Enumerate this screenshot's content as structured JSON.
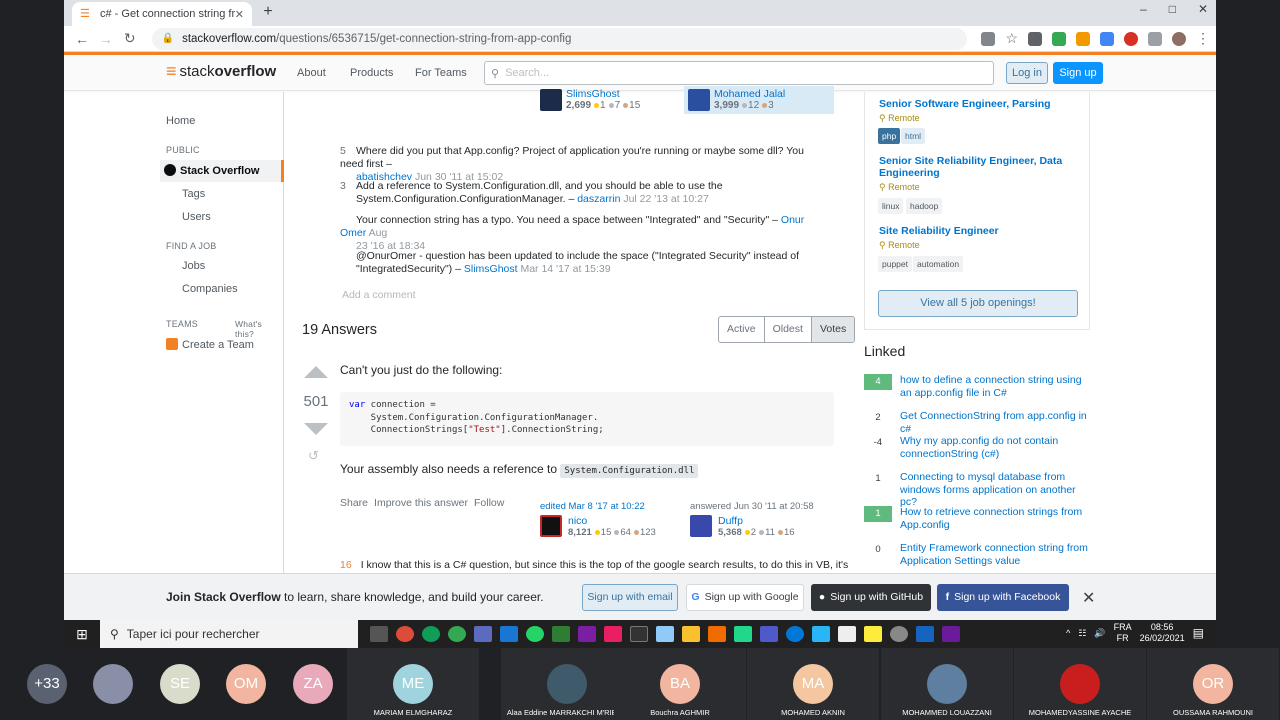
{
  "browser": {
    "tab_title": "c# - Get connection string from ...",
    "url_host": "stackoverflow.com",
    "url_path": "/questions/6536715/get-connection-string-from-app-config"
  },
  "so_header": {
    "logo_text_a": "stack",
    "logo_text_b": "overflow",
    "nav": [
      "About",
      "Products",
      "For Teams"
    ],
    "search_placeholder": "Search...",
    "login": "Log in",
    "signup": "Sign up"
  },
  "left_nav": {
    "home": "Home",
    "public_header": "PUBLIC",
    "stack_overflow": "Stack Overflow",
    "tags": "Tags",
    "users": "Users",
    "find_job_header": "FIND A JOB",
    "jobs": "Jobs",
    "companies": "Companies",
    "teams_header": "TEAMS",
    "whats_this": "What's this?",
    "create_team": "Create a Team"
  },
  "question_users": [
    {
      "name": "SlimsGhost",
      "rep": "2,699",
      "gold": "1",
      "silver": "7",
      "bronze": "15"
    },
    {
      "name": "Mohamed Jalal",
      "rep": "3,999",
      "silver": "12",
      "bronze": "3"
    }
  ],
  "comments": [
    {
      "score": "5",
      "text": "Where did you put that App.config? Project of application you're running or maybe some dll? You need first –",
      "user": "abatishchev",
      "date": "Jun 30 '11 at 15:02"
    },
    {
      "score": "3",
      "text1": "Add a reference to System.Configuration.dll, and you should be able to use the",
      "text2": "System.Configuration.ConfigurationManager. –",
      "user": "daszarrin",
      "date": "Jul 22 '13 at 10:27"
    },
    {
      "score": "",
      "text": "Your connection string has a typo. You need a space between \"Integrated\" and \"Security\" –",
      "user": "Onur Omer",
      "date_a": "Aug",
      "date_b": "23 '16 at 18:34"
    },
    {
      "score": "",
      "text1": "@OnurOmer - question has been updated to include the space (\"Integrated Security\" instead of",
      "text2": "\"IntegratedSecurity\") –",
      "user": "SlimsGhost",
      "date": "Mar 14 '17 at 15:39"
    }
  ],
  "add_comment": "Add a comment",
  "answers": {
    "count_label": "19 Answers",
    "sort_tabs": [
      "Active",
      "Oldest",
      "Votes"
    ],
    "sort_selected": "Votes"
  },
  "answer1": {
    "score": "501",
    "intro": "Can't you just do the following:",
    "code_kw": "var",
    "code_l1": " connection =",
    "code_l2": "    System.Configuration.ConfigurationManager.",
    "code_l3a": "    ConnectionStrings[",
    "code_str": "\"Test\"",
    "code_l3b": "].ConnectionString;",
    "para2": "Your assembly also needs a reference to",
    "para2_code": "System.Configuration.dll",
    "actions": [
      "Share",
      "Improve this answer",
      "Follow"
    ],
    "edited_label": "edited Mar 8 '17 at 10:22",
    "editor": {
      "name": "nico",
      "rep": "8,121",
      "gold": "15",
      "silver": "64",
      "bronze": "123"
    },
    "answered_label": "answered Jun 30 '11 at 20:58",
    "author": {
      "name": "Duffp",
      "rep": "5,368",
      "gold": "2",
      "silver": "11",
      "bronze": "16"
    }
  },
  "answer2": {
    "score": "16",
    "text": "I know that this is a C# question, but since this is the top of the google search results, to do this in VB, it's"
  },
  "jobs": [
    {
      "title": "Senior Software Engineer, Parsing",
      "remote": "Remote",
      "tags": [
        "php",
        "html"
      ]
    },
    {
      "title": "Senior Site Reliability Engineer, Data Engineering",
      "remote": "Remote",
      "tags": [
        "linux",
        "hadoop"
      ]
    },
    {
      "title": "Site Reliability Engineer",
      "remote": "Remote",
      "tags": [
        "puppet",
        "automation"
      ]
    }
  ],
  "view_all_jobs": "View all 5 job openings!",
  "linked": {
    "header": "Linked",
    "items": [
      {
        "count": "4",
        "accepted": true,
        "text": "how to define a connection string using an app.config file in C#"
      },
      {
        "count": "2",
        "accepted": false,
        "text": "Get ConnectionString from app.config in c#"
      },
      {
        "count": "-4",
        "accepted": false,
        "text": "Why my app.config do not contain connectionString (c#)"
      },
      {
        "count": "1",
        "accepted": false,
        "text": "Connecting to mysql database from windows forms application on another pc?"
      },
      {
        "count": "1",
        "accepted": true,
        "text": "How to retrieve connection strings from App.config"
      },
      {
        "count": "0",
        "accepted": false,
        "text": "Entity Framework connection string from Application Settings value"
      }
    ]
  },
  "banner": {
    "bold": "Join Stack Overflow",
    "rest": " to learn, share knowledge, and build your career.",
    "email": "Sign up with email",
    "google": "Sign up with Google",
    "github": "Sign up with GitHub",
    "facebook": "Sign up with Facebook"
  },
  "taskbar": {
    "search_placeholder": "Taper ici pour rechercher",
    "lang1": "FRA",
    "lang2": "FR",
    "time": "08:56",
    "date": "26/02/2021"
  },
  "participants": [
    {
      "label": "+33",
      "name": "",
      "color": "#5a6170"
    },
    {
      "label": "",
      "name": "",
      "color": "#8a8fa8"
    },
    {
      "label": "SE",
      "name": "",
      "color": "#d9dccb"
    },
    {
      "label": "OM",
      "name": "",
      "color": "#f2b59f"
    },
    {
      "label": "ZA",
      "name": "",
      "color": "#e8a9ba"
    },
    {
      "label": "ME",
      "name": "MARIAM ELMGHARAZ",
      "color": "#9fd4df"
    },
    {
      "label": "",
      "name": "Alaa Eddine MARRAKCHI M'RIBHA",
      "color": "#3f5a6a"
    },
    {
      "label": "BA",
      "name": "Bouchra AGHMIR",
      "color": "#f2b59f"
    },
    {
      "label": "MA",
      "name": "MOHAMED AKNIN",
      "color": "#f5c7a0"
    },
    {
      "label": "",
      "name": "MOHAMMED LOUAZZANI",
      "color": "#5e7fa0"
    },
    {
      "label": "",
      "name": "MOHAMEDYASSINE AYACHE",
      "color": "#c81e1e"
    },
    {
      "label": "OR",
      "name": "OUSSAMA RAHMOUNI",
      "color": "#f2b59f"
    }
  ]
}
